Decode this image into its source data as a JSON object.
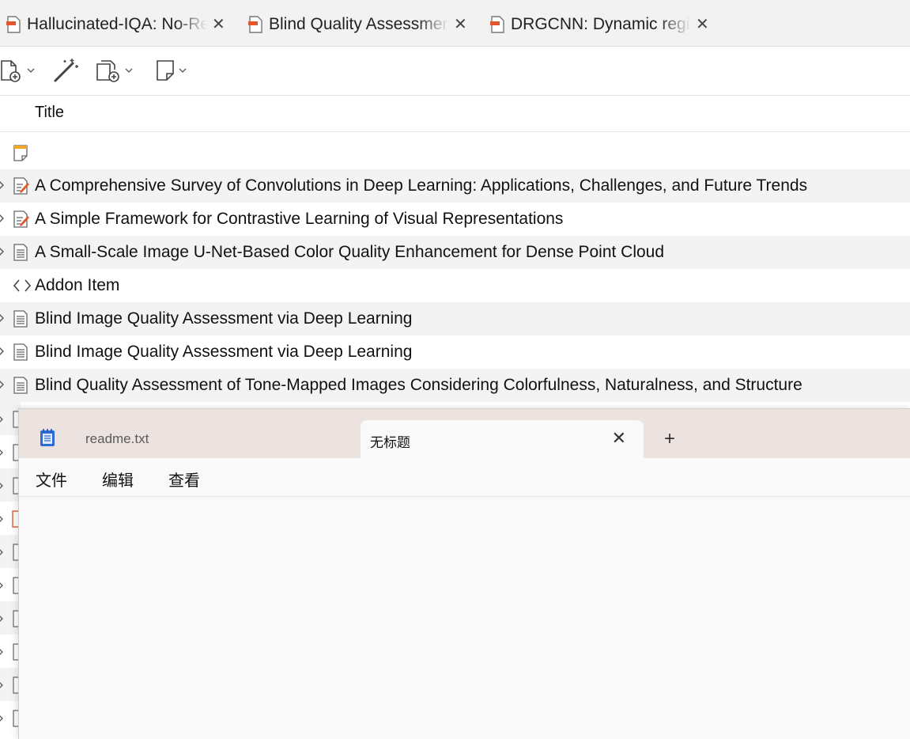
{
  "tabs": [
    {
      "label": "Hallucinated-IQA: No-Reference Image Quality Assessment"
    },
    {
      "label": "Blind Quality Assessment of Tone-Mapped Images"
    },
    {
      "label": "DRGCNN: Dynamic region"
    }
  ],
  "tab_close_glyph": "✕",
  "toolbar": {
    "buttons": [
      {
        "icon": "new-item-icon"
      },
      {
        "icon": "magic-wand-icon"
      },
      {
        "icon": "add-attachment-icon"
      },
      {
        "icon": "new-note-icon"
      }
    ]
  },
  "items": {
    "column_title": "Title",
    "rows": [
      {
        "title": "",
        "icon": "note-icon"
      },
      {
        "title": "A Comprehensive Survey of Convolutions in Deep Learning: Applications, Challenges, and Future Trends",
        "icon": "preprint-icon"
      },
      {
        "title": "A Simple Framework for Contrastive Learning of Visual Representations",
        "icon": "preprint-icon"
      },
      {
        "title": "A Small-Scale Image U-Net-Based Color Quality Enhancement for Dense Point Cloud",
        "icon": "journal-article-icon"
      },
      {
        "title": "Addon Item",
        "icon": "code-icon"
      },
      {
        "title": "Blind Image Quality Assessment via Deep Learning",
        "icon": "journal-article-icon"
      },
      {
        "title": "Blind Image Quality Assessment via Deep Learning",
        "icon": "journal-article-icon"
      },
      {
        "title": "Blind Quality Assessment of Tone-Mapped Images Considering Colorfulness, Naturalness, and Structure",
        "icon": "journal-article-icon"
      }
    ]
  },
  "notepad": {
    "tabs": [
      {
        "label": "readme.txt"
      },
      {
        "label": "无标题"
      }
    ],
    "new_tab": "+",
    "close_glyph": "✕",
    "menu": [
      "文件",
      "编辑",
      "查看"
    ],
    "content": ""
  },
  "colors": {
    "accent_pdf": "#e2572c",
    "row_alt": "#f3f3f3",
    "notepad_tabbar": "#ece2df",
    "notepad_icon": "#2c6bd8"
  }
}
